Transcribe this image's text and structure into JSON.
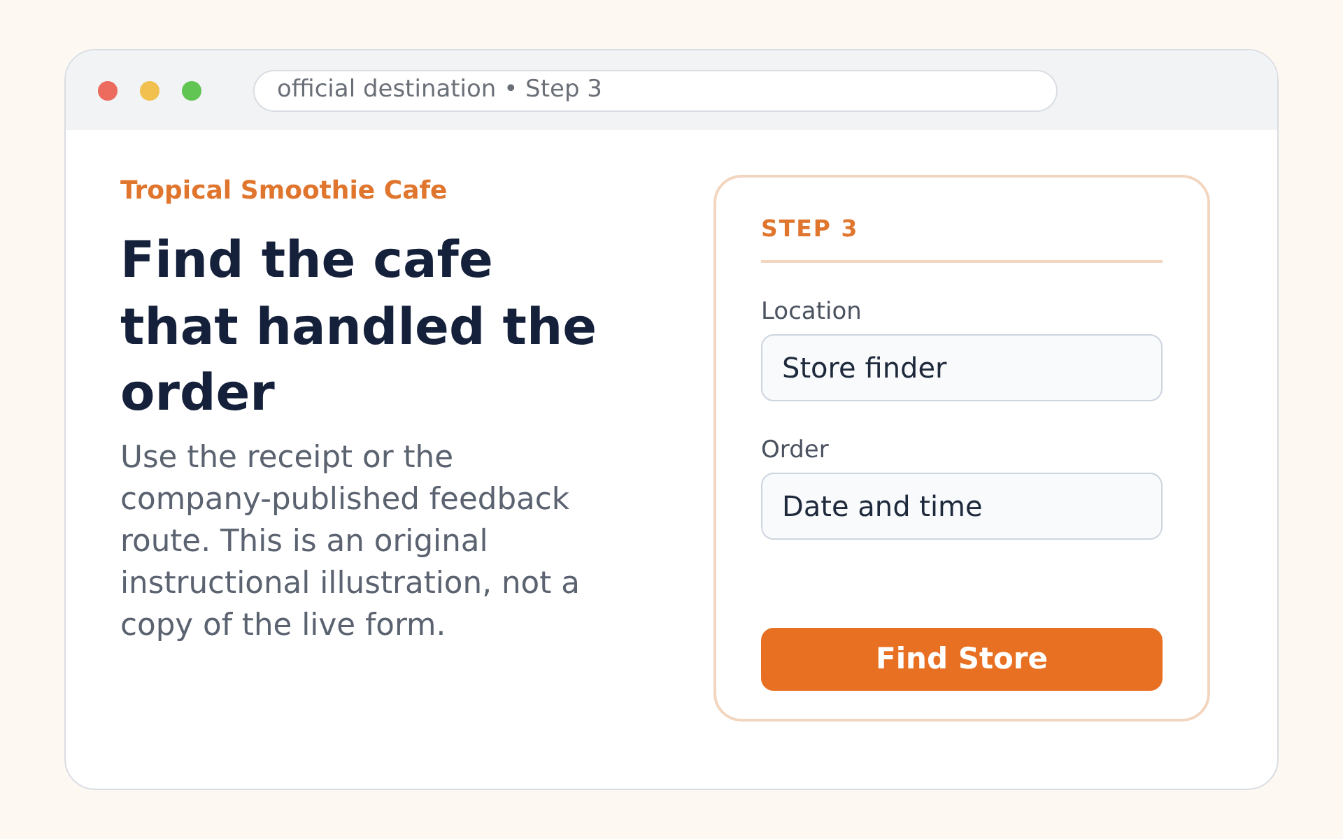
{
  "browser": {
    "address": "official destination • Step 3"
  },
  "intro": {
    "brand": "Tropical Smoothie Cafe",
    "heading": "Find the cafe that handled the order",
    "body": "Use the receipt or the company-published feedback route. This is an original instructional illustration, not a copy of the live form."
  },
  "form_card": {
    "step": "STEP 3",
    "fields": [
      {
        "label": "Location",
        "value": "Store finder"
      },
      {
        "label": "Order",
        "value": "Date and time"
      }
    ],
    "button": "Find Store"
  }
}
